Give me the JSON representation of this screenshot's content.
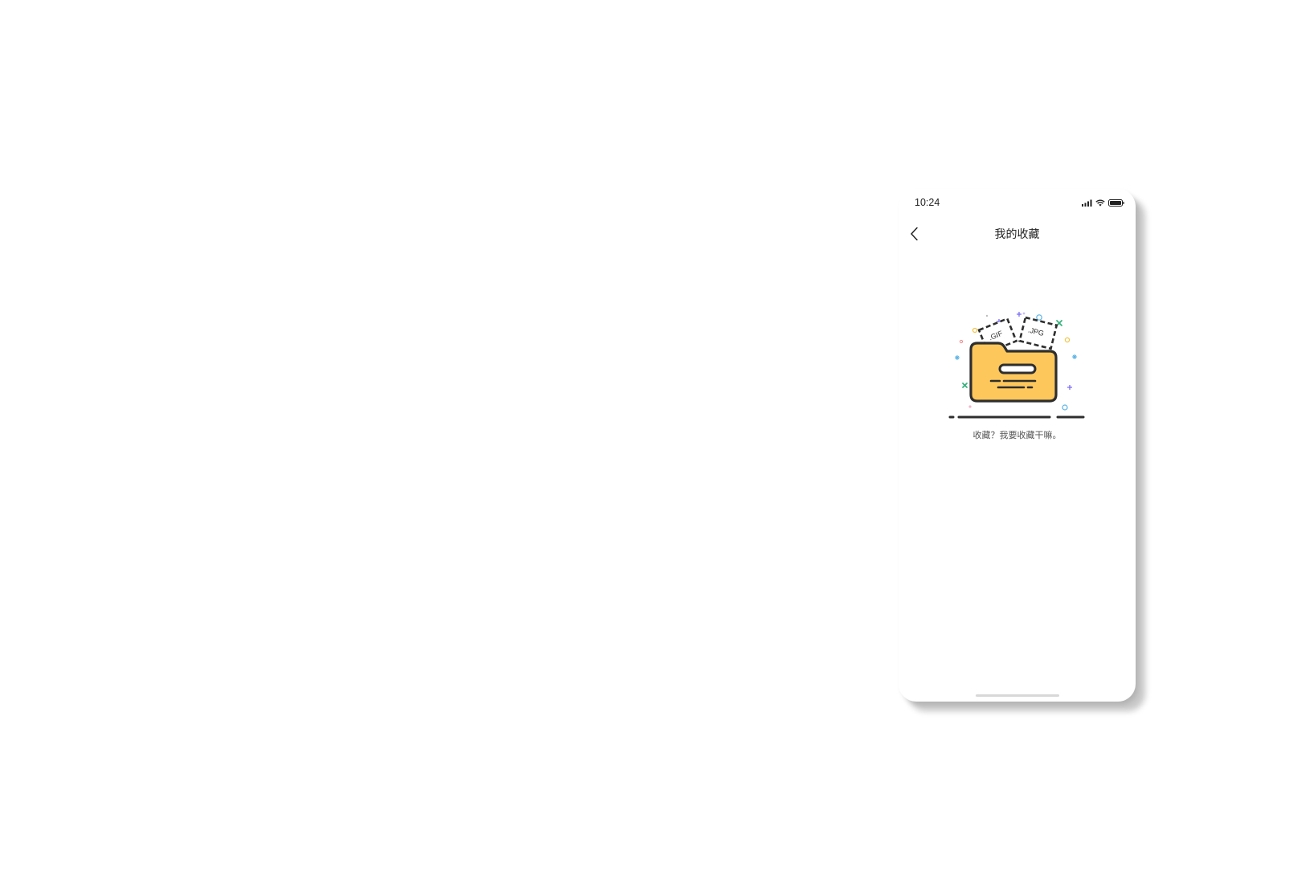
{
  "status_bar": {
    "time": "10:24",
    "icons": [
      "signal-icon",
      "wifi-icon",
      "battery-icon"
    ]
  },
  "nav": {
    "back_icon": "chevron-left-icon",
    "title": "我的收藏"
  },
  "empty_state": {
    "illustration": "folder-illustration",
    "file_tags": [
      ".GIF",
      ".JPG"
    ],
    "message": "收藏？我要收藏干嘛。"
  },
  "colors": {
    "folder_fill": "#FDC75B",
    "outline": "#2E2E2E",
    "accent_green": "#36B37E",
    "accent_purple": "#7B6CF6",
    "accent_blue": "#5AB3E6",
    "accent_yellow": "#F5C342",
    "home_indicator": "#D8D8D8"
  }
}
